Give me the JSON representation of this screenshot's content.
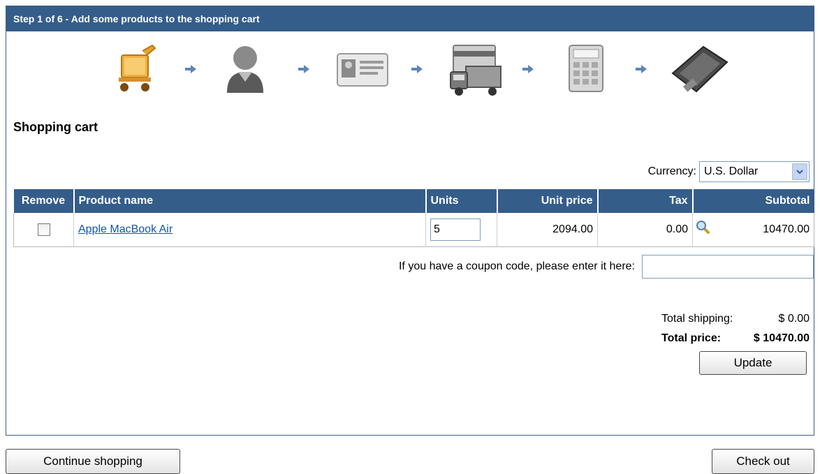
{
  "header": {
    "title": "Step 1 of 6 - Add some products to the shopping cart"
  },
  "steps": [
    {
      "name": "cart-icon"
    },
    {
      "name": "customer-icon"
    },
    {
      "name": "id-card-icon"
    },
    {
      "name": "shipping-truck-icon"
    },
    {
      "name": "calculator-icon"
    },
    {
      "name": "payment-icon"
    }
  ],
  "cart": {
    "title": "Shopping cart",
    "currency_label": "Currency:",
    "currency_value": "U.S. Dollar",
    "columns": [
      "Remove",
      "Product name",
      "Units",
      "Unit price",
      "Tax",
      "Subtotal"
    ],
    "items": [
      {
        "product": "Apple MacBook Air",
        "units": "5",
        "unit_price": "2094.00",
        "tax": "0.00",
        "subtotal": "10470.00",
        "remove_checked": false
      }
    ],
    "coupon_label": "If you have a coupon code, please enter it here:",
    "coupon_value": "",
    "total_shipping_label": "Total shipping:",
    "total_shipping_value": "$ 0.00",
    "total_price_label": "Total price:",
    "total_price_value": "$ 10470.00",
    "update_label": "Update"
  },
  "footer": {
    "continue_label": "Continue shopping",
    "checkout_label": "Check out"
  },
  "colors": {
    "header_bg": "#355d8a",
    "link": "#1155aa",
    "step_arrow": "#5b86b8"
  }
}
